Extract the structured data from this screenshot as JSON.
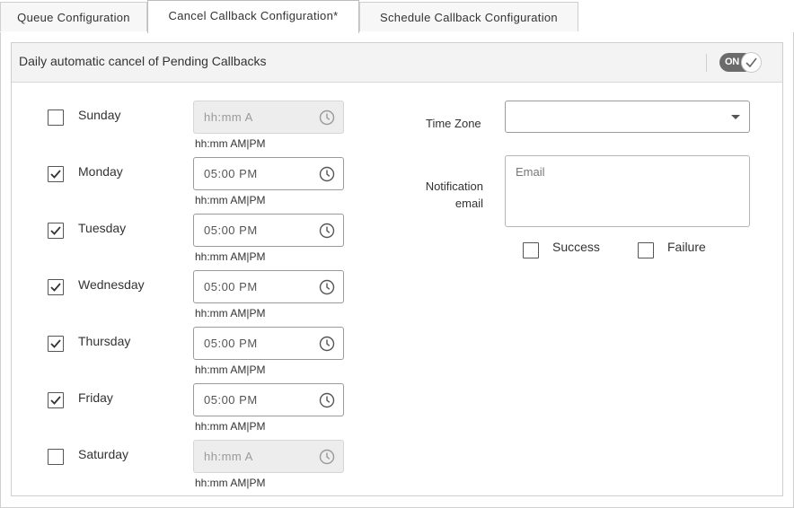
{
  "tabs": [
    {
      "label": "Queue Configuration",
      "active": false
    },
    {
      "label": "Cancel Callback Configuration*",
      "active": true
    },
    {
      "label": "Schedule Callback Configuration",
      "active": false
    }
  ],
  "panel": {
    "title": "Daily automatic cancel of Pending Callbacks",
    "toggle_label": "ON",
    "toggle_on": true
  },
  "days": [
    {
      "label": "Sunday",
      "checked": false,
      "value": "hh:mm A",
      "disabled": true,
      "hint": "hh:mm AM|PM"
    },
    {
      "label": "Monday",
      "checked": true,
      "value": "05:00 PM",
      "disabled": false,
      "hint": "hh:mm AM|PM"
    },
    {
      "label": "Tuesday",
      "checked": true,
      "value": "05:00 PM",
      "disabled": false,
      "hint": "hh:mm AM|PM"
    },
    {
      "label": "Wednesday",
      "checked": true,
      "value": "05:00 PM",
      "disabled": false,
      "hint": "hh:mm AM|PM"
    },
    {
      "label": "Thursday",
      "checked": true,
      "value": "05:00 PM",
      "disabled": false,
      "hint": "hh:mm AM|PM"
    },
    {
      "label": "Friday",
      "checked": true,
      "value": "05:00 PM",
      "disabled": false,
      "hint": "hh:mm AM|PM"
    },
    {
      "label": "Saturday",
      "checked": false,
      "value": "hh:mm A",
      "disabled": true,
      "hint": "hh:mm AM|PM"
    }
  ],
  "timezone": {
    "label": "Time Zone",
    "value": ""
  },
  "notification": {
    "label_line1": "Notification",
    "label_line2": "email",
    "placeholder": "Email",
    "success_label": "Success",
    "success_checked": false,
    "failure_label": "Failure",
    "failure_checked": false
  },
  "colors": {
    "accent": "#6b6b6b",
    "check": "#333333"
  },
  "icons": {
    "time": "clock-icon",
    "check": "checkmark-icon",
    "dropdown": "chevron-down-icon"
  }
}
